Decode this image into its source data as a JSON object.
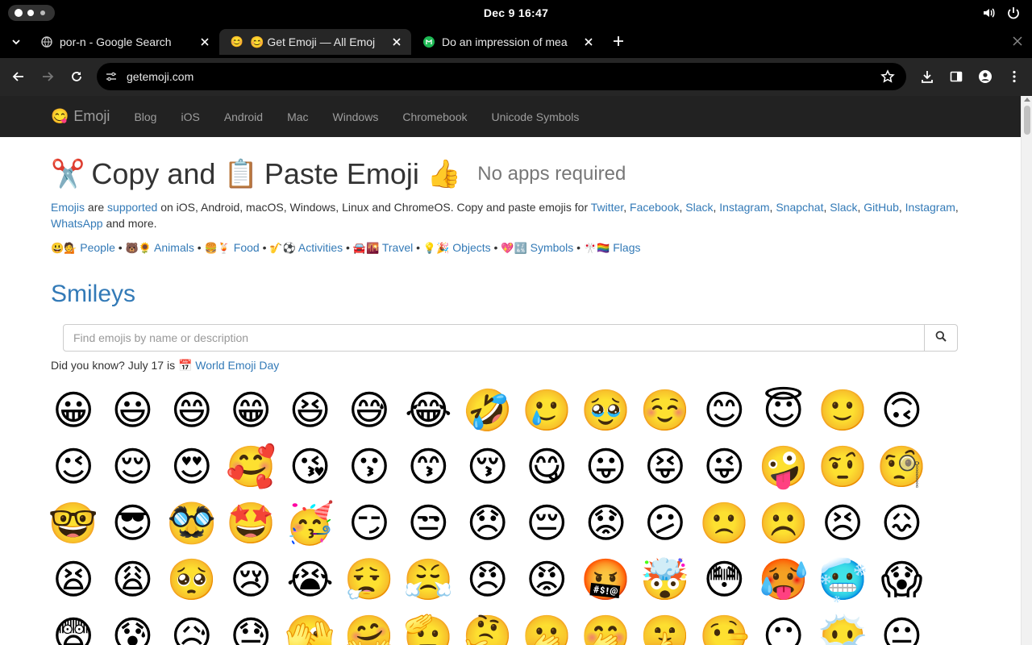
{
  "system": {
    "clock": "Dec 9  16:47",
    "icons": [
      "volume-icon",
      "power-icon"
    ]
  },
  "tabs": [
    {
      "title": "por-n - Google Search",
      "favicon": "google-icon",
      "active": false
    },
    {
      "title": "😊 Get Emoji — All Emoj",
      "favicon": "😊",
      "active": true
    },
    {
      "title": "Do an impression of mea",
      "favicon": "chatbot-icon",
      "active": false
    }
  ],
  "toolbar": {
    "url": "getemoji.com"
  },
  "site": {
    "brand_icon": "😋",
    "brand": "Emoji",
    "nav": [
      "Blog",
      "iOS",
      "Android",
      "Mac",
      "Windows",
      "Chromebook",
      "Unicode Symbols"
    ]
  },
  "page": {
    "h1": {
      "icon1": "✂️",
      "part1": "Copy and",
      "icon2": "📋",
      "part2": "Paste Emoji",
      "icon3": "👍",
      "sub": "No apps required"
    },
    "intro": {
      "emojis": "Emojis",
      "are": "are",
      "supported": "supported",
      "rest": "on iOS, Android, macOS, Windows, Linux and ChromeOS. Copy and paste emojis for",
      "twitter": "Twitter",
      "facebook": "Facebook",
      "slack": "Slack",
      "instagram": "Instagram",
      "snapchat": "Snapchat",
      "slack2": "Slack",
      "github": "GitHub",
      "instagram2": "Instagram",
      "whatsapp": "WhatsApp",
      "and_more": "and more."
    },
    "categories": [
      {
        "icons": "😃💁",
        "label": "People"
      },
      {
        "icons": "🐻🌻",
        "label": "Animals"
      },
      {
        "icons": "🍔🍹",
        "label": "Food"
      },
      {
        "icons": "🎷⚽️",
        "label": "Activities"
      },
      {
        "icons": "🚘🌇",
        "label": "Travel"
      },
      {
        "icons": "💡🎉",
        "label": "Objects"
      },
      {
        "icons": "💖🔣",
        "label": "Symbols"
      },
      {
        "icons": "🎌🏳️‍🌈",
        "label": "Flags"
      }
    ],
    "section_title": "Smileys",
    "search_placeholder": "Find emojis by name or description",
    "did_you_know": "Did you know? July 17 is",
    "calendar_icon": "📅",
    "world_emoji_day": "World Emoji Day",
    "emojis": [
      "😀",
      "😃",
      "😄",
      "😁",
      "😆",
      "😅",
      "😂",
      "🤣",
      "🥲",
      "🥹",
      "☺️",
      "😊",
      "😇",
      "🙂",
      "🙃",
      "😉",
      "😌",
      "😍",
      "🥰",
      "😘",
      "😗",
      "😙",
      "😚",
      "😋",
      "😛",
      "😝",
      "😜",
      "🤪",
      "🤨",
      "🧐",
      "🤓",
      "😎",
      "🥸",
      "🤩",
      "🥳",
      "😏",
      "😒",
      "😞",
      "😔",
      "😟",
      "😕",
      "🙁",
      "☹️",
      "😣",
      "😖",
      "😫",
      "😩",
      "🥺",
      "😢",
      "😭",
      "😮‍💨",
      "😤",
      "😠",
      "😡",
      "🤬",
      "🤯",
      "😳",
      "🥵",
      "🥶",
      "😱",
      "😨",
      "😰",
      "😥",
      "😓",
      "🫣",
      "🤗",
      "🫡",
      "🤔",
      "🫢",
      "🤭",
      "🤫",
      "🤥",
      "😶",
      "😶‍🌫️",
      "😐"
    ]
  }
}
